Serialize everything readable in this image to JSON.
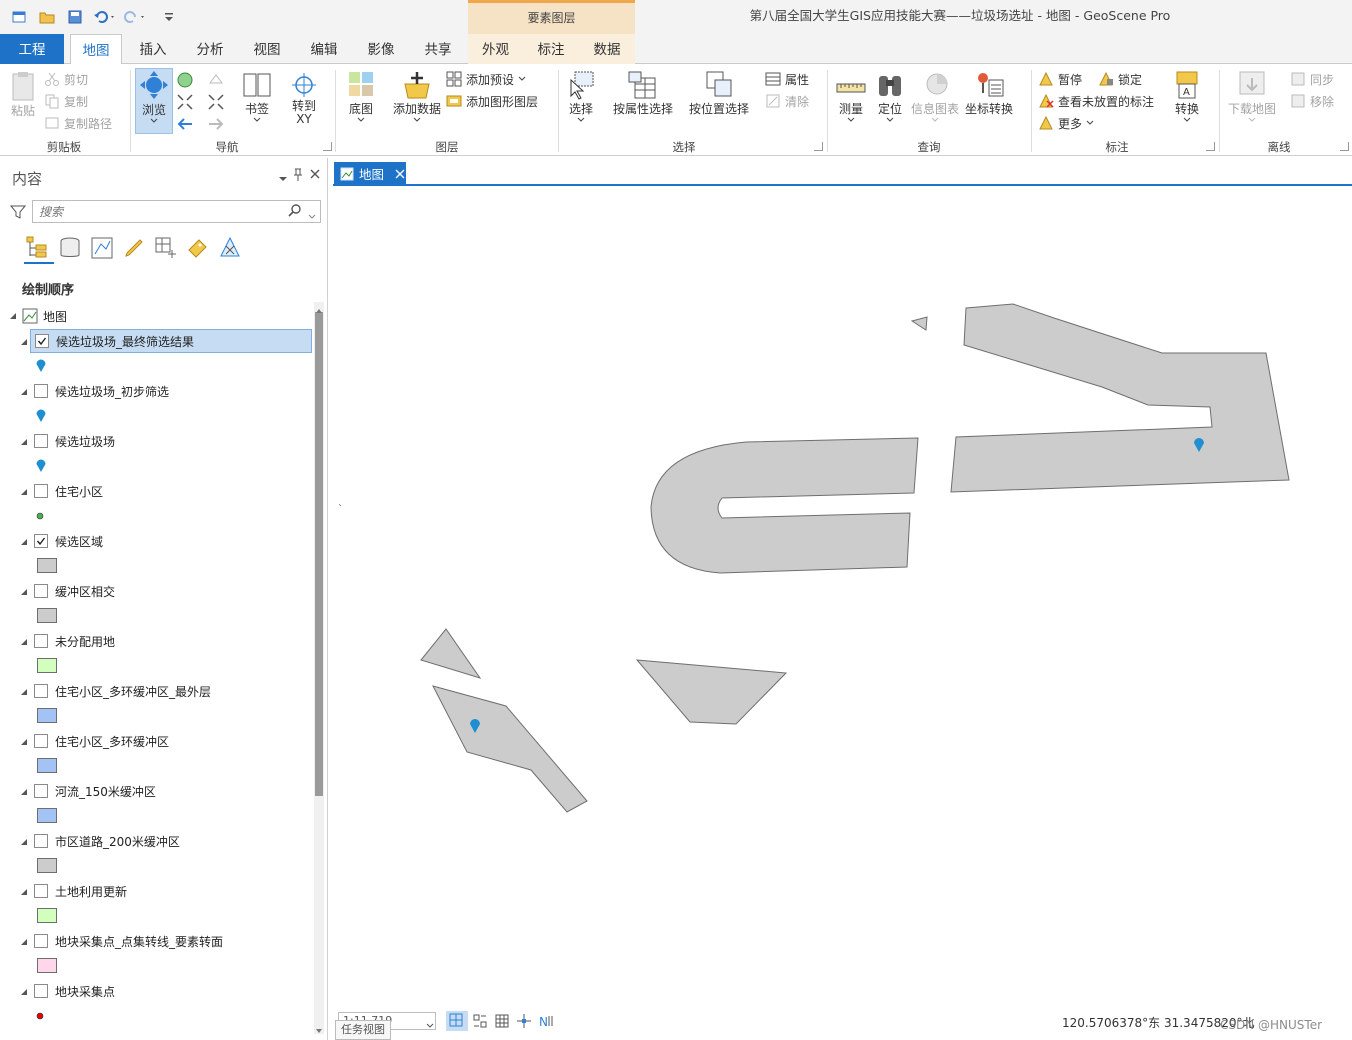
{
  "window": {
    "title": "第八届全国大学生GIS应用技能大赛——垃圾场选址 - 地图 - GeoScene Pro",
    "context_header": "要素图层"
  },
  "tabs": [
    {
      "label": "工程"
    },
    {
      "label": "地图"
    },
    {
      "label": "插入"
    },
    {
      "label": "分析"
    },
    {
      "label": "视图"
    },
    {
      "label": "编辑"
    },
    {
      "label": "影像"
    },
    {
      "label": "共享"
    },
    {
      "label": "外观"
    },
    {
      "label": "标注"
    },
    {
      "label": "数据"
    }
  ],
  "ribbon": {
    "clipboard": {
      "group": "剪贴板",
      "paste": "粘贴",
      "cut": "剪切",
      "copy": "复制",
      "copy_path": "复制路径"
    },
    "navigate": {
      "group": "导航",
      "explore": "浏览",
      "bookmarks": "书签",
      "goto_xy": "转到\nXY"
    },
    "layer": {
      "group": "图层",
      "basemap": "底图",
      "add_data": "添加数据",
      "add_preset": "添加预设",
      "add_graphics": "添加图形图层"
    },
    "selection": {
      "group": "选择",
      "select": "选择",
      "by_attr": "按属性选择",
      "by_loc": "按位置选择",
      "attributes": "属性",
      "clear": "清除"
    },
    "inquiry": {
      "group": "查询",
      "measure": "测量",
      "locate": "定位",
      "infographics": "信息图表",
      "coord_conv": "坐标转换"
    },
    "labeling": {
      "group": "标注",
      "pause": "暂停",
      "lock": "锁定",
      "view_unplaced": "查看未放置的标注",
      "more": "更多",
      "convert": "转换"
    },
    "offline": {
      "group": "离线",
      "download": "下载地图",
      "sync": "同步",
      "remove": "移除"
    }
  },
  "contents": {
    "title": "内容",
    "search_placeholder": "搜索",
    "section": "绘制顺序",
    "map_name": "地图",
    "layers": [
      {
        "name": "候选垃圾场_最终筛选结果",
        "checked": true,
        "selected": true,
        "symbol": "pin",
        "color": "#1f8fd1"
      },
      {
        "name": "候选垃圾场_初步筛选",
        "checked": false,
        "symbol": "pin",
        "color": "#1f8fd1"
      },
      {
        "name": "候选垃圾场",
        "checked": false,
        "symbol": "pin",
        "color": "#1f8fd1"
      },
      {
        "name": "住宅小区",
        "checked": false,
        "symbol": "dot",
        "color": "#4caf50"
      },
      {
        "name": "候选区域",
        "checked": true,
        "symbol": "fill",
        "color": "#cccccc"
      },
      {
        "name": "缓冲区相交",
        "checked": false,
        "symbol": "fill",
        "color": "#cccccc"
      },
      {
        "name": "未分配用地",
        "checked": false,
        "symbol": "fill",
        "color": "#d3ffbe"
      },
      {
        "name": "住宅小区_多环缓冲区_最外层",
        "checked": false,
        "symbol": "fill",
        "color": "#a3c3f5"
      },
      {
        "name": "住宅小区_多环缓冲区",
        "checked": false,
        "symbol": "fill",
        "color": "#a3c3f5"
      },
      {
        "name": "河流_150米缓冲区",
        "checked": false,
        "symbol": "fill",
        "color": "#a3c3f5"
      },
      {
        "name": "市区道路_200米缓冲区",
        "checked": false,
        "symbol": "fill",
        "color": "#cccccc"
      },
      {
        "name": "土地利用更新",
        "checked": false,
        "symbol": "fill",
        "color": "#d3ffbe"
      },
      {
        "name": "地块采集点_点集转线_要素转面",
        "checked": false,
        "symbol": "fill",
        "color": "#ffd6ea"
      },
      {
        "name": "地块采集点",
        "checked": false,
        "symbol": "dot",
        "color": "#e00000"
      }
    ]
  },
  "map_view": {
    "tab_label": "地图",
    "accent": "#1e73c8",
    "polygon_fill": "#cccccc",
    "polygon_stroke": "#6e6e6e",
    "pin_color": "#1f8fd1"
  },
  "status": {
    "scale": "1:11,719",
    "coords": "120.5706378°东 31.3475820°北",
    "task_view": "任务视图",
    "watermark": "CSDN @HNUSTer"
  }
}
